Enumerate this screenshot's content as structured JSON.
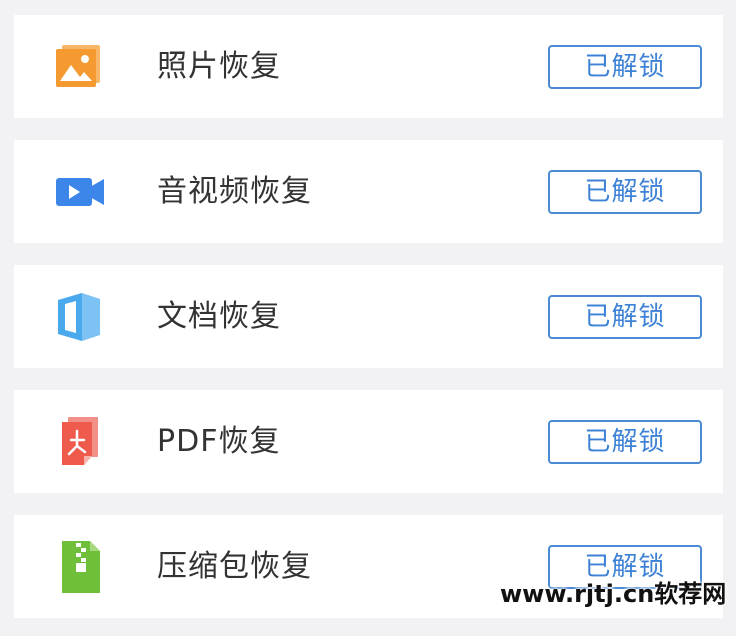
{
  "items": [
    {
      "label": "照片恢复",
      "button": "已解锁",
      "icon": "photo-icon",
      "color": "#f59a31"
    },
    {
      "label": "音视频恢复",
      "button": "已解锁",
      "icon": "video-icon",
      "color": "#3b86e8"
    },
    {
      "label": "文档恢复",
      "button": "已解锁",
      "icon": "document-icon",
      "color": "#4aa8ec"
    },
    {
      "label": "PDF恢复",
      "button": "已解锁",
      "icon": "pdf-icon",
      "color": "#ee5a4c"
    },
    {
      "label": "压缩包恢复",
      "button": "已解锁",
      "icon": "zip-icon",
      "color": "#6fbf3a"
    }
  ],
  "watermark": "www.rjtj.cn软荐网",
  "colors": {
    "background": "#f2f2f4",
    "card": "#ffffff",
    "button_border": "#4a8ad4",
    "button_text": "#3d82d6",
    "label_text": "#333333"
  }
}
